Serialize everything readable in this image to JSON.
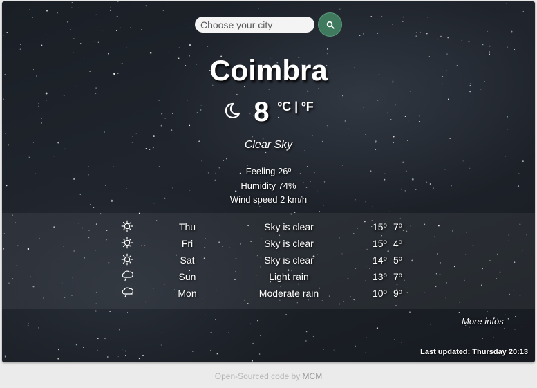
{
  "search": {
    "placeholder": "Choose your city",
    "button_icon": "search-icon"
  },
  "weather": {
    "city": "Coimbra",
    "current_icon": "moon-icon",
    "temperature": "8",
    "units": "ºC | ºF",
    "description": "Clear Sky",
    "feeling": "Feeling 26º",
    "humidity": "Humidity 74%",
    "wind": "Wind speed 2 km/h"
  },
  "forecast": [
    {
      "icon": "sun-icon",
      "day": "Thu",
      "desc": "Sky is clear",
      "hi": "15º",
      "lo": "7º"
    },
    {
      "icon": "sun-icon",
      "day": "Fri",
      "desc": "Sky is clear",
      "hi": "15º",
      "lo": "4º"
    },
    {
      "icon": "sun-icon",
      "day": "Sat",
      "desc": "Sky is clear",
      "hi": "14º",
      "lo": "5º"
    },
    {
      "icon": "rain-icon",
      "day": "Sun",
      "desc": "Light rain",
      "hi": "13º",
      "lo": "7º"
    },
    {
      "icon": "rain-icon",
      "day": "Mon",
      "desc": "Moderate rain",
      "hi": "10º",
      "lo": "9º"
    }
  ],
  "more_infos": "More infos",
  "last_updated": "Last updated: Thursday 20:13",
  "footer": {
    "prefix": "Open-Sourced code by",
    "author": "MCM"
  },
  "colors": {
    "search_button": "#3f7a5e",
    "background_page": "#ebebeb"
  }
}
